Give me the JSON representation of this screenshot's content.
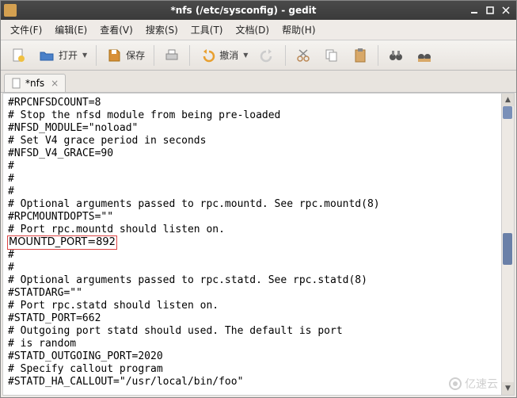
{
  "titlebar": {
    "text": "*nfs (/etc/sysconfig) - gedit"
  },
  "menus": {
    "file": "文件(F)",
    "edit": "编辑(E)",
    "view": "查看(V)",
    "search": "搜索(S)",
    "tools": "工具(T)",
    "docs": "文档(D)",
    "help": "帮助(H)"
  },
  "toolbar": {
    "open": "打开",
    "save": "保存",
    "undo": "撤消"
  },
  "tab": {
    "label": "*nfs"
  },
  "editor": {
    "lines": [
      "#RPCNFSDCOUNT=8",
      "# Stop the nfsd module from being pre-loaded",
      "#NFSD_MODULE=\"noload\"",
      "# Set V4 grace period in seconds",
      "#NFSD_V4_GRACE=90",
      "#",
      "#",
      "#",
      "# Optional arguments passed to rpc.mountd. See rpc.mountd(8)",
      "#RPCMOUNTDOPTS=\"\"",
      "# Port rpc.mountd should listen on.",
      "MOUNTD_PORT=892",
      "#",
      "#",
      "# Optional arguments passed to rpc.statd. See rpc.statd(8)",
      "#STATDARG=\"\"",
      "# Port rpc.statd should listen on.",
      "#STATD_PORT=662",
      "# Outgoing port statd should used. The default is port",
      "# is random",
      "#STATD_OUTGOING_PORT=2020",
      "# Specify callout program",
      "#STATD_HA_CALLOUT=\"/usr/local/bin/foo\""
    ],
    "highlight_line_index": 11
  },
  "watermark": {
    "text": "亿速云"
  }
}
